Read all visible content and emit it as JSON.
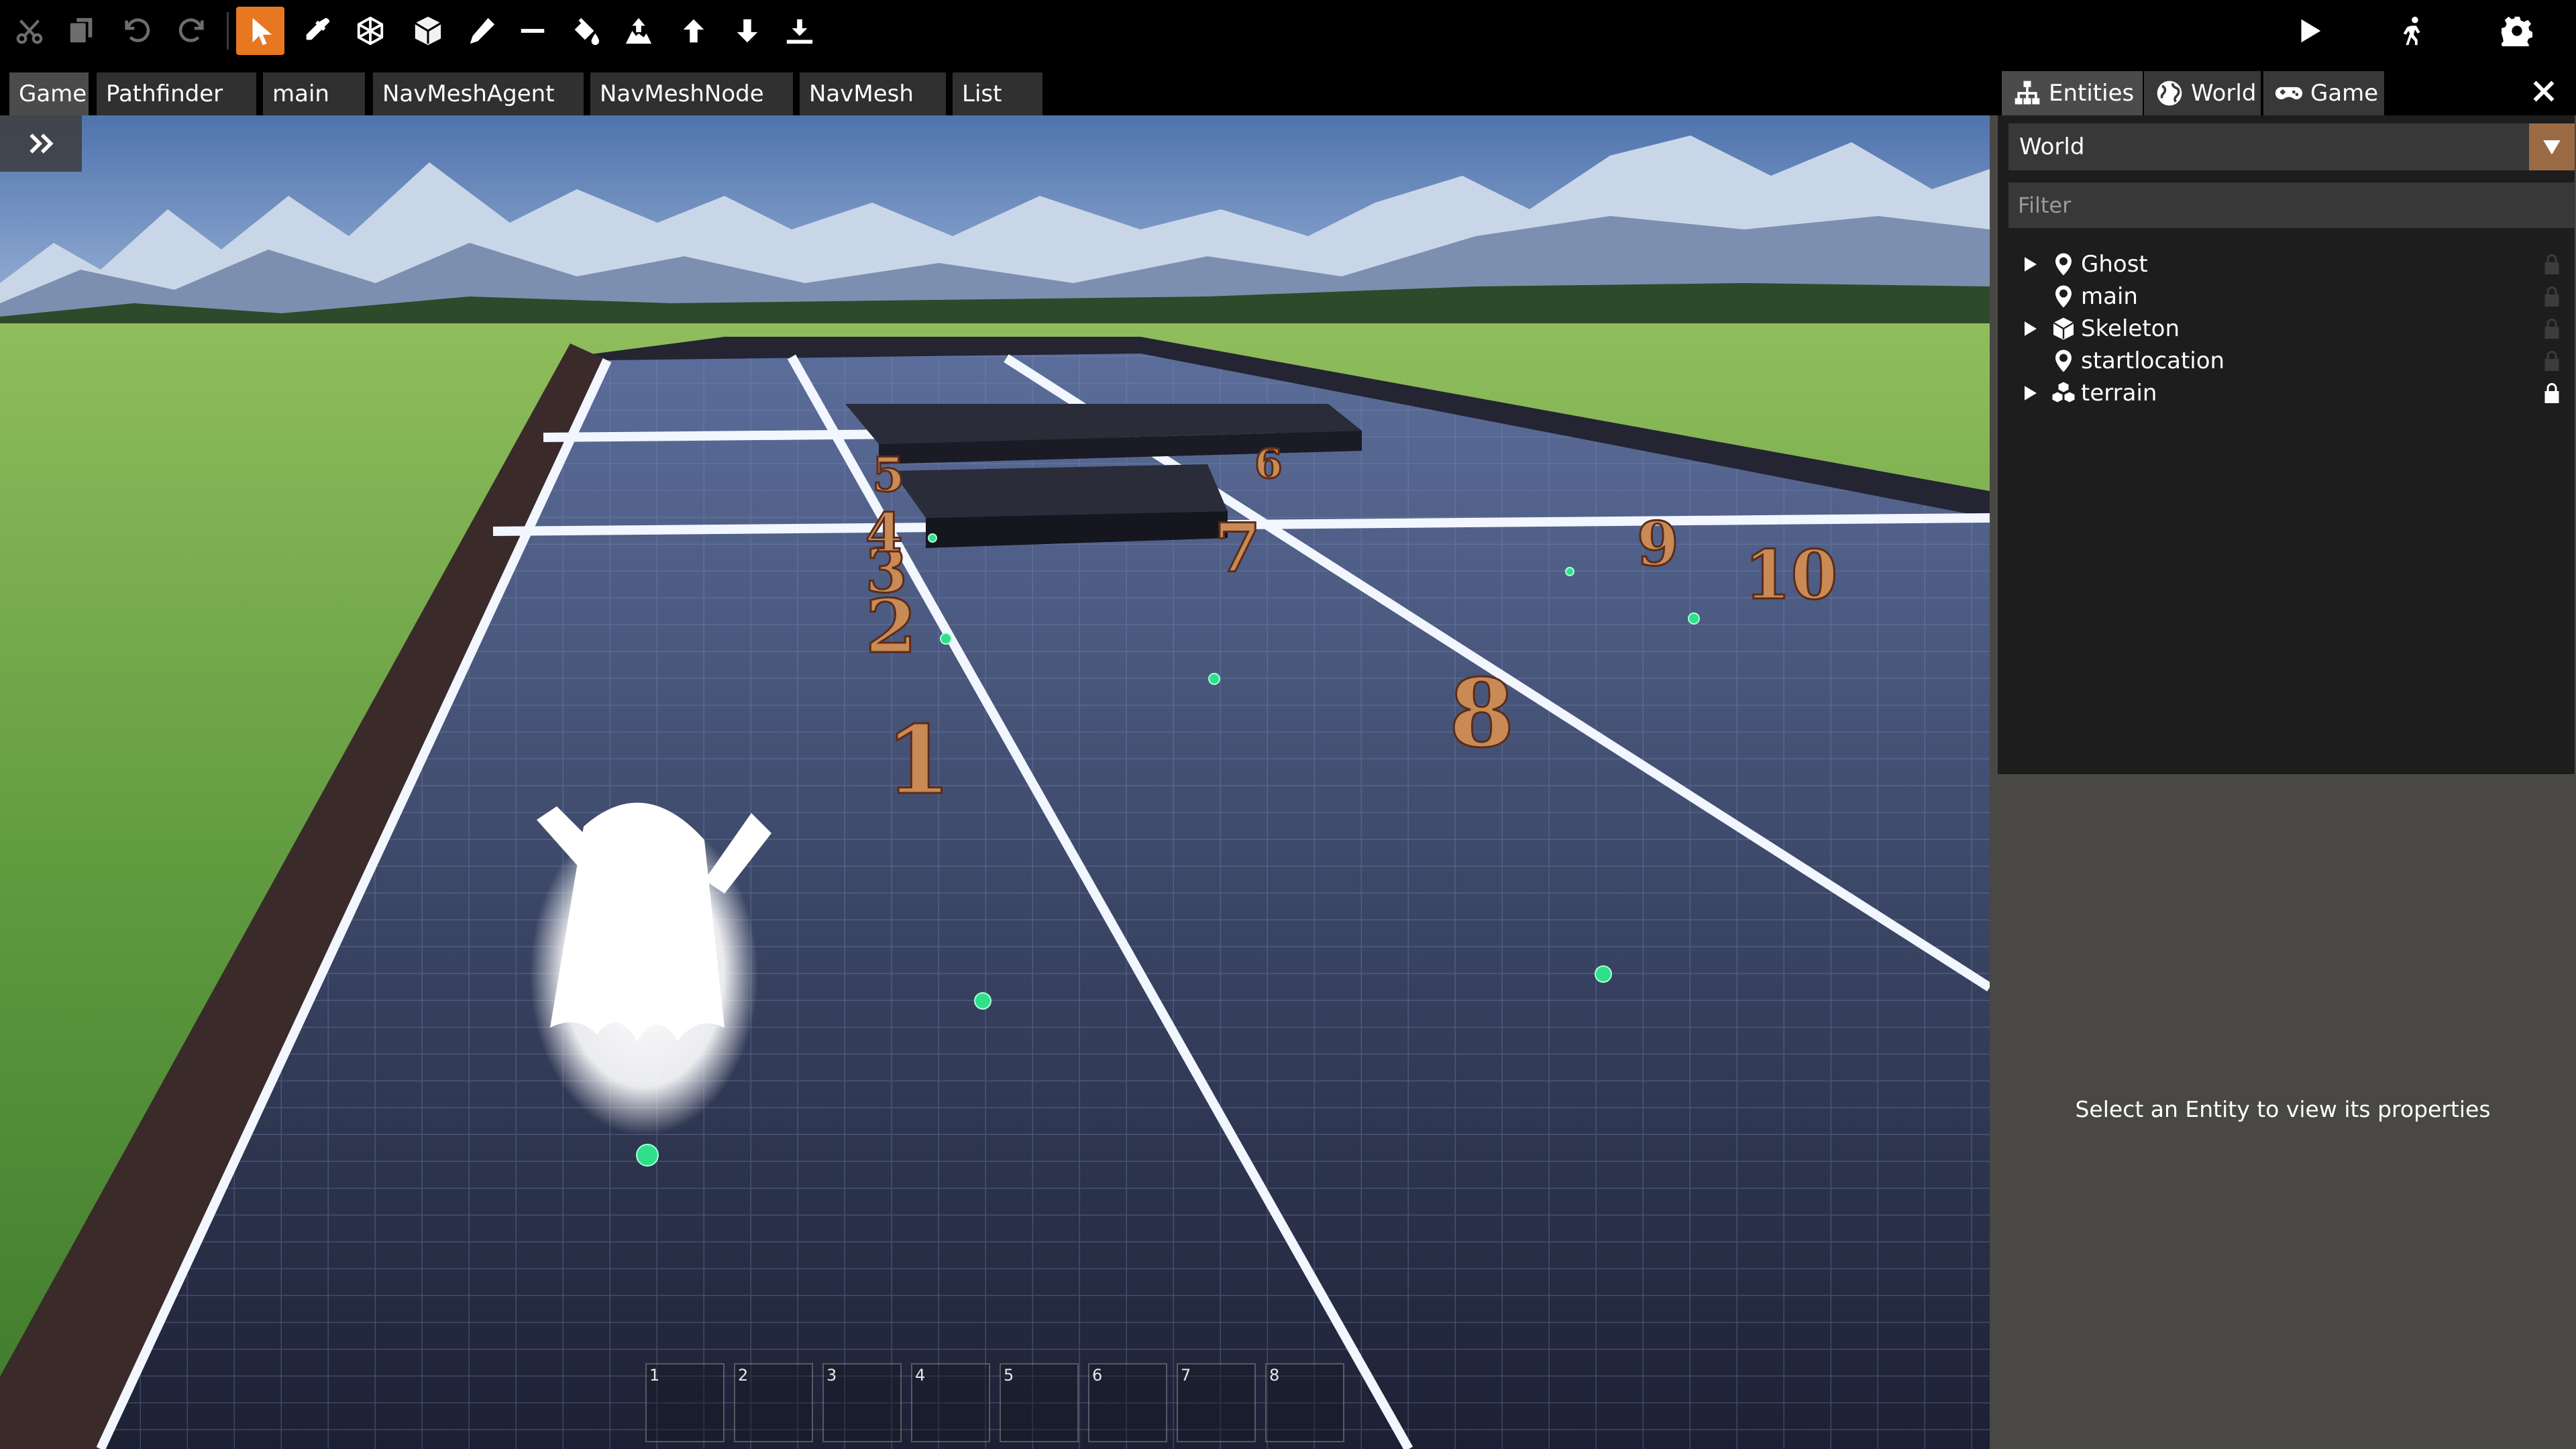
{
  "toolbar": {
    "tools": [
      {
        "name": "cut-icon",
        "dim": true
      },
      {
        "name": "copy-icon",
        "dim": true
      },
      {
        "name": "undo-icon",
        "dim": true
      },
      {
        "name": "redo-icon",
        "dim": true
      },
      {
        "name": "select-icon",
        "active": true
      },
      {
        "name": "eyedropper-icon"
      },
      {
        "name": "mesh-icon"
      },
      {
        "name": "cube-icon"
      },
      {
        "name": "pencil-icon"
      },
      {
        "name": "line-icon"
      },
      {
        "name": "paint-bucket-icon"
      },
      {
        "name": "terrain-raise-icon"
      },
      {
        "name": "arrow-up-icon"
      },
      {
        "name": "arrow-down-icon"
      },
      {
        "name": "flatten-icon"
      }
    ],
    "right_tools": [
      "play-icon",
      "walk-icon",
      "settings-icon"
    ]
  },
  "tabs": [
    "Game",
    "Pathfinder",
    "main",
    "NavMeshAgent",
    "NavMeshNode",
    "NavMesh",
    "List"
  ],
  "active_tab": "Game",
  "panel": {
    "tabs": [
      {
        "label": "Entities",
        "icon": "hierarchy-icon"
      },
      {
        "label": "World",
        "icon": "globe-icon"
      },
      {
        "label": "Game",
        "icon": "gamepad-icon"
      }
    ],
    "active_tab": "Entities",
    "world_select": "World",
    "filter_placeholder": "Filter",
    "entities": [
      {
        "label": "Ghost",
        "icon": "map-pin-icon",
        "expandable": true,
        "locked": false
      },
      {
        "label": "main",
        "icon": "map-pin-icon",
        "expandable": false,
        "locked": false
      },
      {
        "label": "Skeleton",
        "icon": "cube-icon",
        "expandable": true,
        "locked": false
      },
      {
        "label": "startlocation",
        "icon": "map-pin-icon",
        "expandable": false,
        "locked": false
      },
      {
        "label": "terrain",
        "icon": "cubes-icon",
        "expandable": true,
        "locked": true
      }
    ],
    "hint": "Select an Entity to view its properties"
  },
  "viewport": {
    "waypoint_numbers": [
      "1",
      "2",
      "3",
      "4",
      "5",
      "6",
      "7",
      "8",
      "9",
      "10"
    ],
    "hotbar_slots": [
      "1",
      "2",
      "3",
      "4",
      "5",
      "6",
      "7",
      "8"
    ]
  }
}
